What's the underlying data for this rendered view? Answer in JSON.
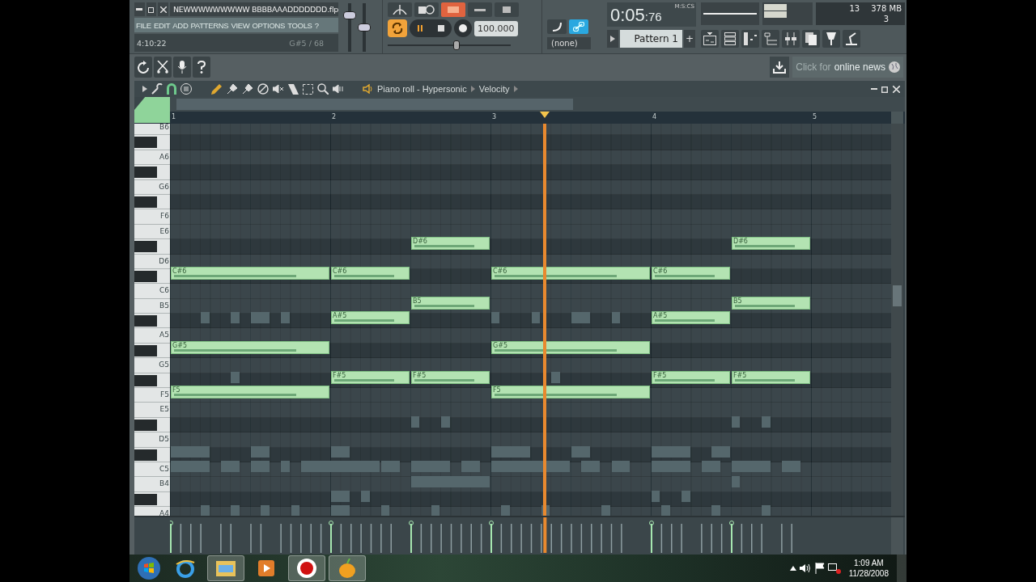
{
  "project": {
    "file_name": "NEWWWWWWWWW BBBBAAADDDDDDD.flp"
  },
  "menu": [
    "FILE",
    "EDIT",
    "ADD",
    "PATTERNS",
    "VIEW",
    "OPTIONS",
    "TOOLS",
    "?"
  ],
  "hint_bar": {
    "time": "4:10:22",
    "note": "G#5 / 68"
  },
  "master_sliders": [
    {
      "level": 0.8
    },
    {
      "level": 0.5
    }
  ],
  "transport": {
    "tempo": "100.000",
    "tempo_slider": {
      "level": 0.58
    },
    "snap_linked": true,
    "channel": "(none)"
  },
  "time_display": {
    "format": "M:S:CS",
    "time": "0:05",
    "centiseconds": ":76"
  },
  "pattern": {
    "name": "Pattern 1",
    "add": "+"
  },
  "monitor": {
    "cpu": "13",
    "memory": "378 MB",
    "polyphony": "3"
  },
  "news": {
    "prefix": "Click for",
    "link": "online news"
  },
  "piano_roll": {
    "title": "Piano roll - Hypersonic",
    "target": "Velocity",
    "ruler": [
      "1",
      "2",
      "3",
      "4",
      "5"
    ],
    "playhead": {
      "level": 0.52
    },
    "keys": [
      {
        "kind": "white",
        "label": "B6"
      },
      {
        "kind": "black"
      },
      {
        "kind": "white",
        "label": "A6"
      },
      {
        "kind": "black"
      },
      {
        "kind": "white",
        "label": "G6"
      },
      {
        "kind": "black"
      },
      {
        "kind": "white",
        "label": "F6"
      },
      {
        "kind": "white",
        "label": "E6"
      },
      {
        "kind": "black",
        "sequence": [
          {
            "kind": "rest_bar"
          },
          {
            "kind": "rest_half"
          },
          {
            "kind": "note_half",
            "label": "D#6"
          },
          {
            "kind": "rest_bar"
          },
          {
            "kind": "rest_half"
          },
          {
            "kind": "note_half",
            "label": "D#6"
          }
        ]
      },
      {
        "kind": "white",
        "label": "D6"
      },
      {
        "kind": "black",
        "sequence": [
          {
            "kind": "note_bar",
            "label": "C#6"
          },
          {
            "kind": "note_half",
            "label": "C#6"
          },
          {
            "kind": "rest_half"
          },
          {
            "kind": "note_bar",
            "label": "C#6"
          },
          {
            "kind": "note_half",
            "label": "C#6"
          }
        ]
      },
      {
        "kind": "white",
        "label": "C6"
      },
      {
        "kind": "white",
        "label": "B5",
        "sequence": [
          {
            "kind": "rest_bar"
          },
          {
            "kind": "rest_half"
          },
          {
            "kind": "note_half",
            "label": "B5"
          },
          {
            "kind": "rest_bar"
          },
          {
            "kind": "rest_half"
          },
          {
            "kind": "note_half",
            "label": "B5"
          }
        ]
      },
      {
        "kind": "black",
        "sequence": [
          {
            "kind": "rest_bar"
          },
          {
            "kind": "note_half",
            "label": "A#5"
          },
          {
            "kind": "rest_half"
          },
          {
            "kind": "rest_bar"
          },
          {
            "kind": "note_half",
            "label": "A#5"
          }
        ]
      },
      {
        "kind": "white",
        "label": "A5"
      },
      {
        "kind": "black",
        "sequence": [
          {
            "kind": "note_bar",
            "label": "G#5"
          },
          {
            "kind": "rest_bar"
          },
          {
            "kind": "note_bar",
            "label": "G#5"
          }
        ]
      },
      {
        "kind": "white",
        "label": "G5"
      },
      {
        "kind": "black",
        "sequence": [
          {
            "kind": "rest_bar"
          },
          {
            "kind": "note_half",
            "label": "F#5"
          },
          {
            "kind": "note_half",
            "label": "F#5"
          },
          {
            "kind": "rest_bar"
          },
          {
            "kind": "note_half",
            "label": "F#5"
          },
          {
            "kind": "note_half",
            "label": "F#5"
          }
        ]
      },
      {
        "kind": "white",
        "label": "F5",
        "sequence": [
          {
            "kind": "note_bar",
            "label": "F5"
          },
          {
            "kind": "rest_bar"
          },
          {
            "kind": "note_bar",
            "label": "F5"
          }
        ]
      },
      {
        "kind": "white",
        "label": "E5"
      },
      {
        "kind": "black"
      },
      {
        "kind": "white",
        "label": "D5"
      },
      {
        "kind": "black"
      },
      {
        "kind": "white",
        "label": "C5"
      },
      {
        "kind": "white",
        "label": "B4"
      },
      {
        "kind": "black"
      },
      {
        "kind": "white",
        "label": "A4"
      }
    ]
  },
  "taskbar": {
    "apps": [
      {
        "kind": "browser",
        "selected": false
      },
      {
        "kind": "folder",
        "selected": true
      },
      {
        "kind": "media",
        "selected": false
      },
      {
        "kind": "recorder",
        "selected": true
      },
      {
        "kind": "fruit",
        "selected": true
      }
    ],
    "clock": {
      "time": "1:09 AM",
      "date": "11/28/2008"
    }
  }
}
